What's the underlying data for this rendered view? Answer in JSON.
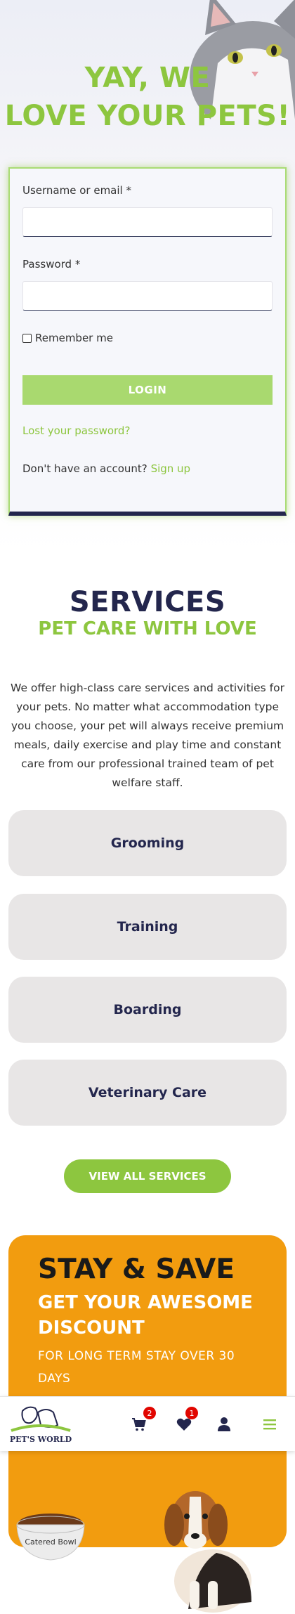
{
  "hero": {
    "title_line1": "YAY, WE",
    "title_line2": "LOVE YOUR PETS!"
  },
  "login": {
    "username_label": "Username or email *",
    "username_value": "",
    "password_label": "Password *",
    "password_value": "",
    "remember_label": "Remember me",
    "remember_checked": false,
    "login_button": "LOGIN",
    "lost_password_link": "Lost your password?",
    "no_account_text": "Don't have an account?",
    "signup_link": "Sign up"
  },
  "services": {
    "title": "SERVICES",
    "subtitle": "PET CARE WITH LOVE",
    "description": "We offer high-class care services and activities for your pets. No matter what accommodation type you choose, your pet will always receive premium meals, daily exercise and play time and constant care from our professional trained team of pet welfare staff.",
    "items": [
      {
        "label": "Grooming"
      },
      {
        "label": "Training"
      },
      {
        "label": "Boarding"
      },
      {
        "label": "Veterinary Care"
      }
    ],
    "view_all_button": "VIEW ALL SERVICES"
  },
  "promo": {
    "title": "STAY & SAVE",
    "subtitle": "GET YOUR AWESOME DISCOUNT",
    "note": "FOR LONG TERM STAY OVER 30 DAYS",
    "bowl_brand": "Catered Bowl"
  },
  "bottom_bar": {
    "logo_text": "PET'S WORLD",
    "cart_count": "2",
    "wishlist_count": "1",
    "icons": [
      "cart-icon",
      "heart-icon",
      "user-icon",
      "menu-icon"
    ]
  },
  "colors": {
    "brand_green": "#8dc63f",
    "navy": "#23264d",
    "orange": "#f29c0f",
    "badge_red": "#e10600"
  }
}
